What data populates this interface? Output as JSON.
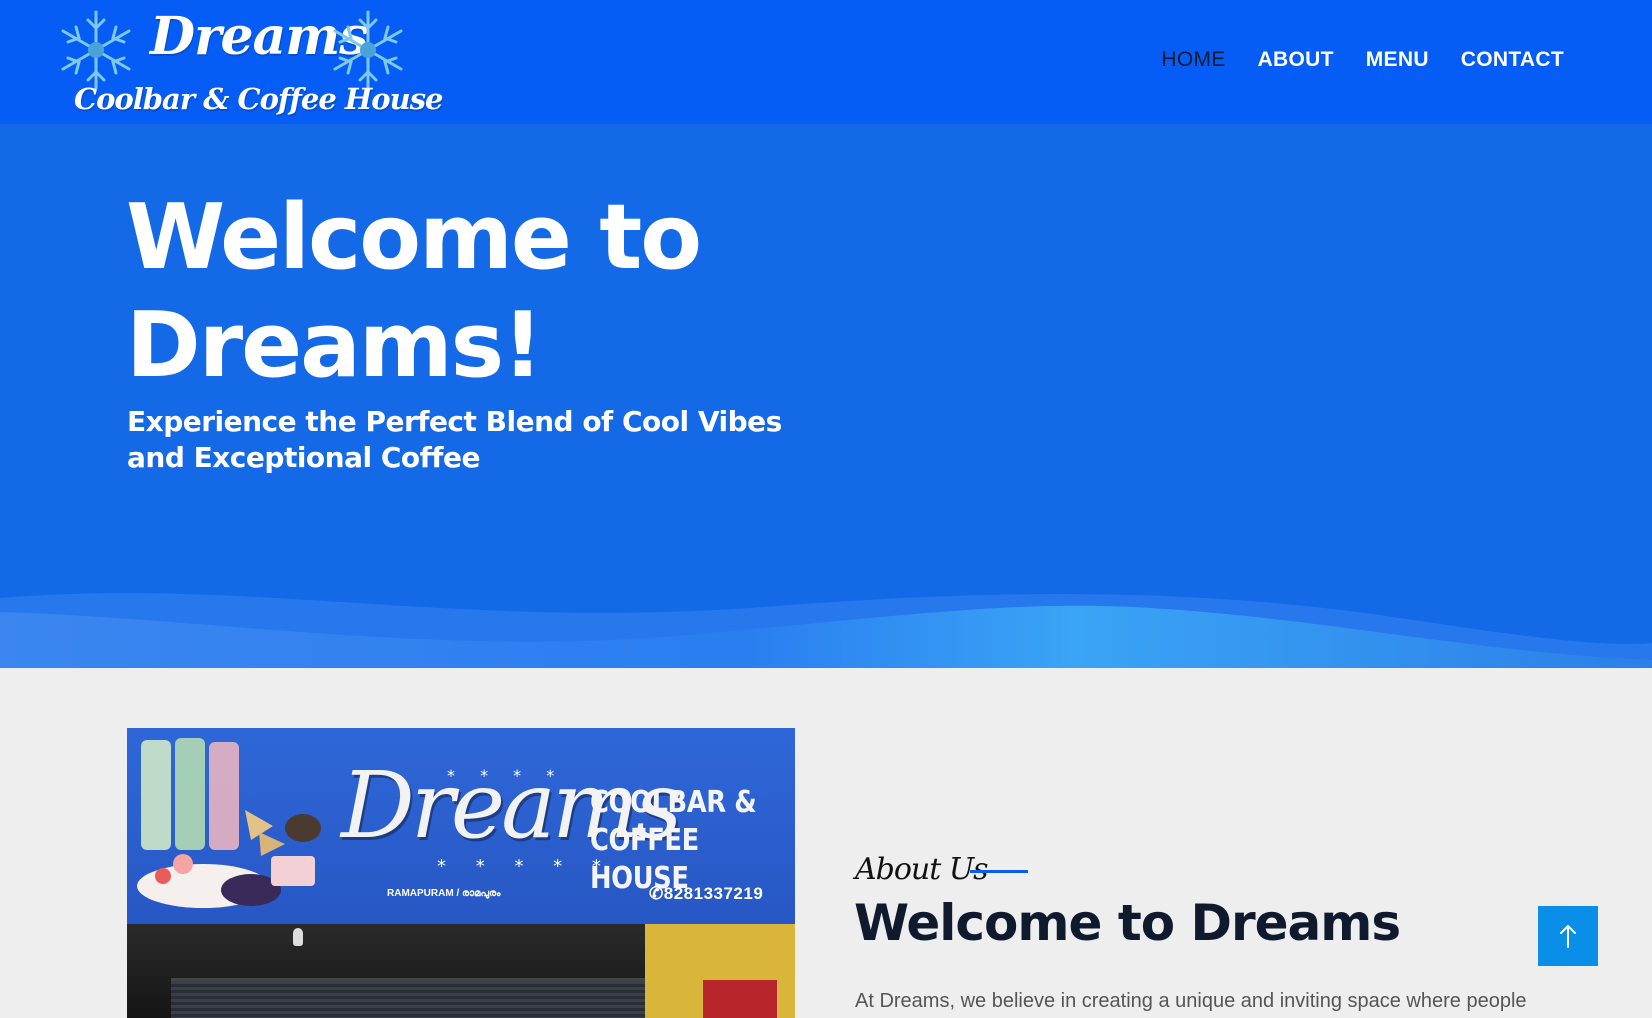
{
  "header": {
    "logo": {
      "brand": "Dreams",
      "tagline": "Coolbar & Coffee House",
      "icons": [
        "snowflake-icon",
        "snowflake-icon"
      ]
    },
    "nav": [
      {
        "label": "HOME",
        "active": true
      },
      {
        "label": "ABOUT",
        "active": false
      },
      {
        "label": "MENU",
        "active": false
      },
      {
        "label": "CONTACT",
        "active": false
      }
    ]
  },
  "hero": {
    "title_line1": "Welcome to",
    "title_line2": "Dreams!",
    "subtitle_line1": "Experience the Perfect Blend of Cool Vibes",
    "subtitle_line2": "and Exceptional Coffee"
  },
  "about": {
    "image": {
      "sign_script": "Dreams",
      "sign_line1": "COOLBAR &",
      "sign_line2": "COFFEE HOUSE",
      "sign_location": "RAMAPURAM / രാമപുരം",
      "sign_phone": "✆8281337219"
    },
    "label": "About Us",
    "title": "Welcome to Dreams",
    "text": "At Dreams, we believe in creating a unique and inviting space where people"
  },
  "scroll_top": {
    "icon": "arrow-up-icon"
  },
  "colors": {
    "header_bg": "#055df5",
    "hero_bg": "#1469e6",
    "accent": "#0a5cf2",
    "scroll_button": "#0a8fe8",
    "page_bg": "#eeeeee"
  }
}
